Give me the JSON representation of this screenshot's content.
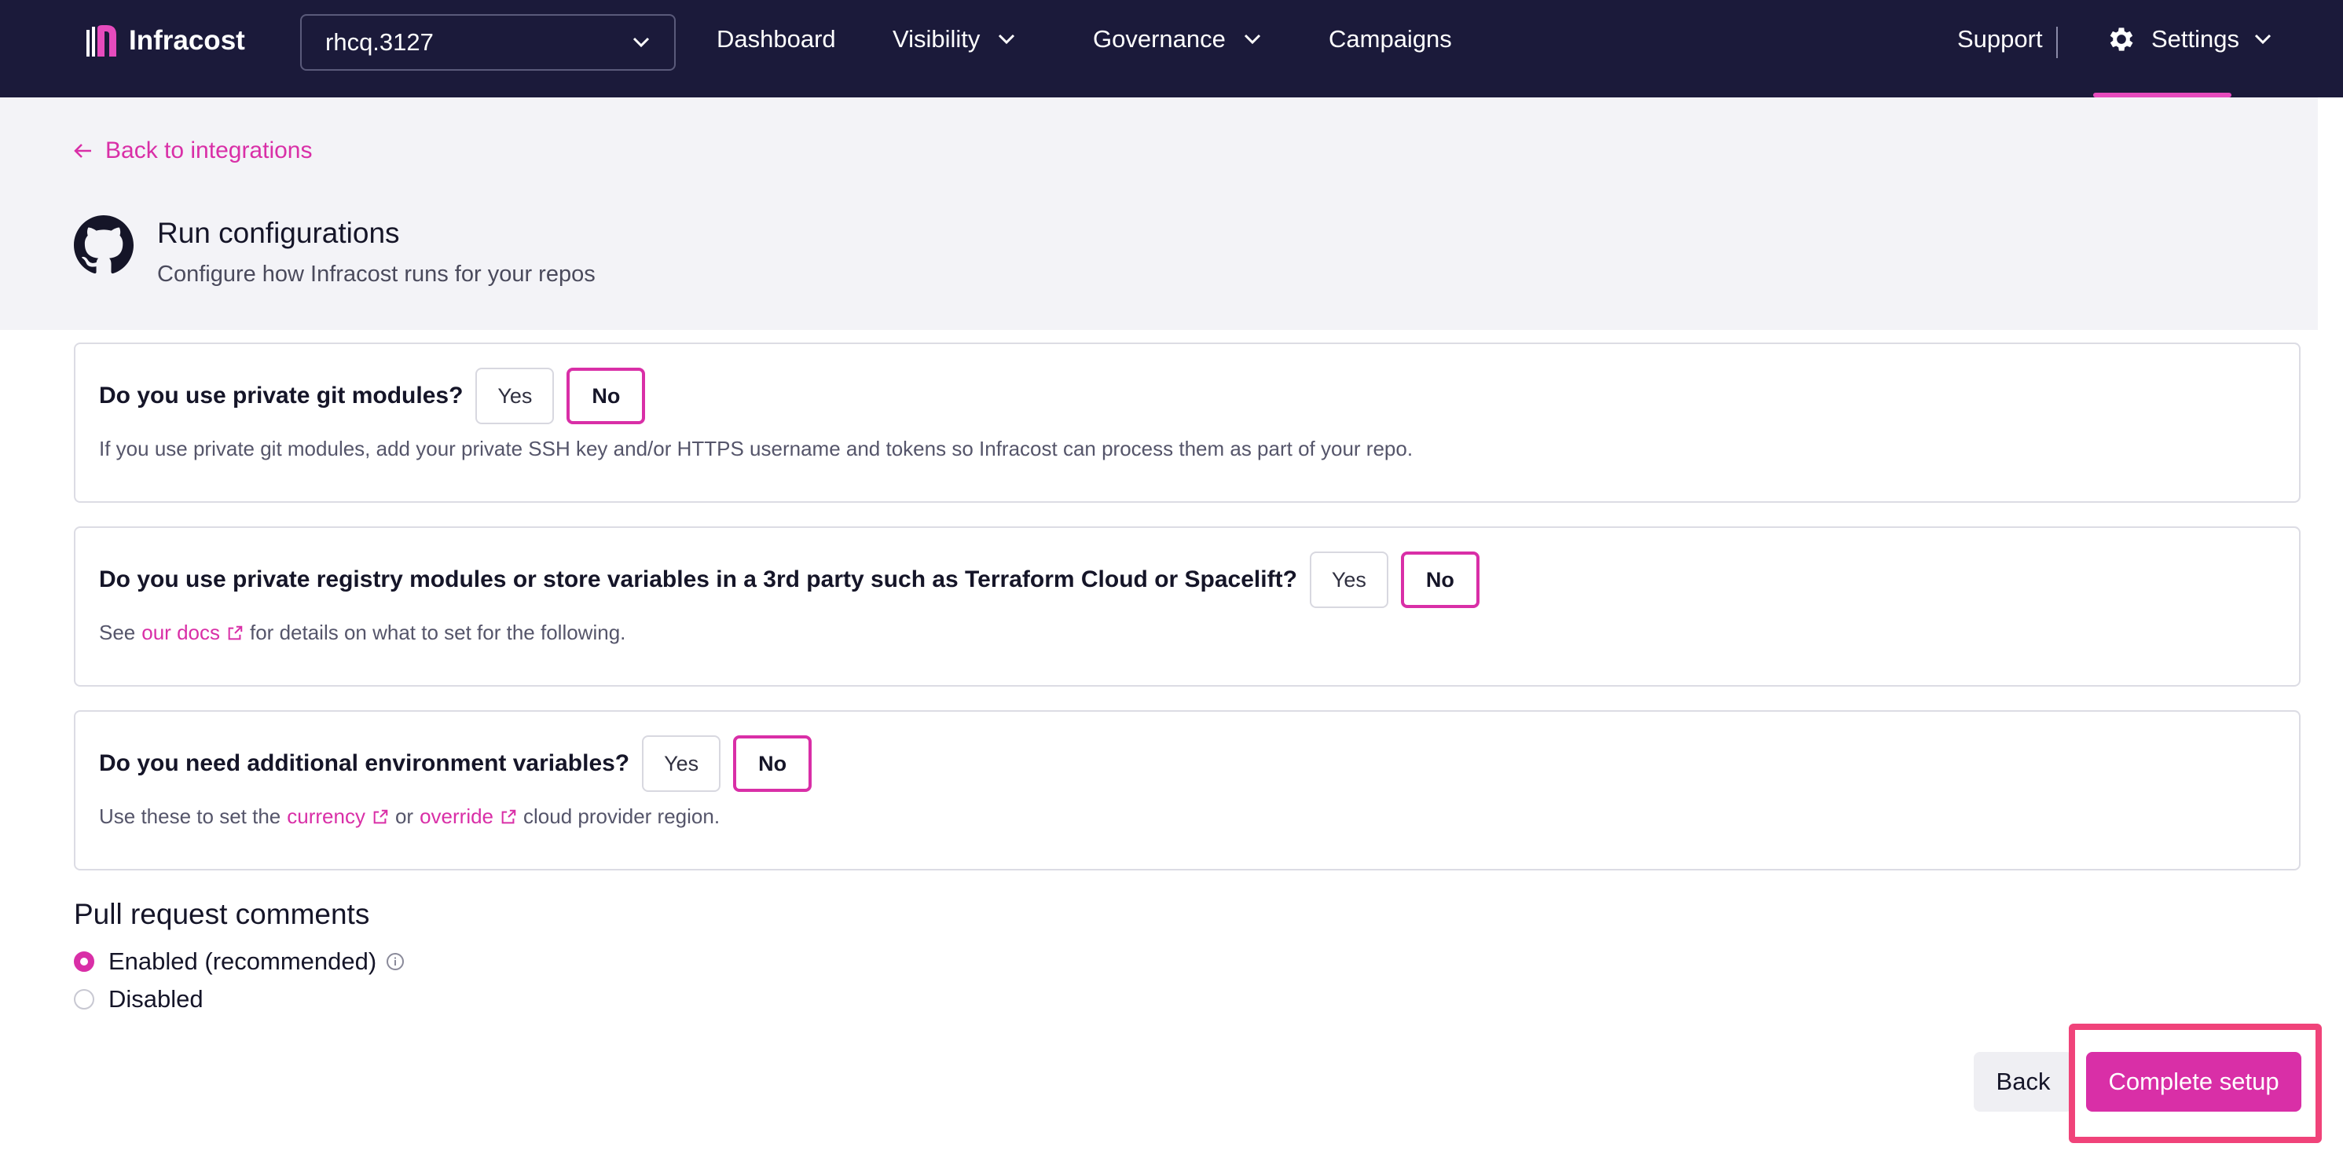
{
  "nav": {
    "logo_text": "Infracost",
    "org_selector": "rhcq.3127",
    "items": [
      "Dashboard",
      "Visibility",
      "Governance",
      "Campaigns"
    ],
    "support": "Support",
    "settings": "Settings"
  },
  "header": {
    "back_link": "Back to integrations",
    "title": "Run configurations",
    "subtitle": "Configure how Infracost runs for your repos"
  },
  "questions": [
    {
      "text": "Do you use private git modules?",
      "yes": "Yes",
      "no": "No",
      "selected": "No",
      "help": "If you use private git modules, add your private SSH key and/or HTTPS username and tokens so Infracost can process them as part of your repo."
    },
    {
      "text": "Do you use private registry modules or store variables in a 3rd party such as Terraform Cloud or Spacelift?",
      "yes": "Yes",
      "no": "No",
      "selected": "No",
      "help_prefix": "See",
      "help_link": "our docs",
      "help_suffix": "for details on what to set for the following."
    },
    {
      "text": "Do you need additional environment variables?",
      "yes": "Yes",
      "no": "No",
      "selected": "No",
      "help_prefix": "Use these to set the",
      "help_link1": "currency",
      "help_mid": "or",
      "help_link2": "override",
      "help_suffix": "cloud provider region."
    }
  ],
  "pr_comments": {
    "title": "Pull request comments",
    "options": [
      "Enabled (recommended)",
      "Disabled"
    ],
    "selected": "Enabled (recommended)"
  },
  "footer": {
    "back": "Back",
    "complete": "Complete setup"
  },
  "colors": {
    "nav_bg": "#1b1a3a",
    "accent": "#d92fa7",
    "highlight": "#f0437a"
  }
}
